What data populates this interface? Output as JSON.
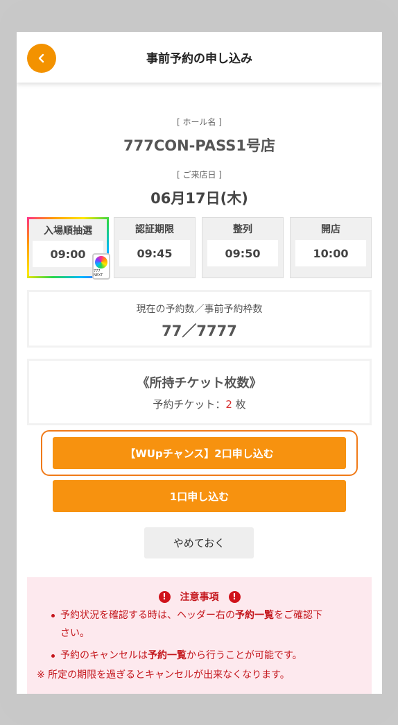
{
  "header": {
    "title": "事前予約の申し込み"
  },
  "hall": {
    "label": "[ ホール名 ]",
    "name": "777CON-PASS1号店"
  },
  "visit": {
    "label": "[ ご来店日 ]",
    "date": "06月17日(木)"
  },
  "schedule": [
    {
      "label": "入場順抽選",
      "time": "09:00"
    },
    {
      "label": "認証期限",
      "time": "09:45"
    },
    {
      "label": "整列",
      "time": "09:50"
    },
    {
      "label": "開店",
      "time": "10:00"
    }
  ],
  "lottery_badge_text": "777 NEXT",
  "reservation": {
    "label": "現在の予約数／事前予約枠数",
    "value": "77／7777"
  },
  "tickets": {
    "title": "《所持チケット枚数》",
    "prefix": "予約チケット：",
    "count": "2",
    "unit": " 枚"
  },
  "buttons": {
    "wup": "【WUpチャンス】2口申し込む",
    "one": "1口申し込む",
    "cancel": "やめておく"
  },
  "notice": {
    "title": "注意事項",
    "item1_pre": "予約状況を確認する時は、ヘッダー右の",
    "item1_bold": "予約一覧",
    "item1_post": "をご確認下",
    "item1_line2": "さい。",
    "item2_pre": "予約のキャンセルは",
    "item2_bold": "予約一覧",
    "item2_post": "から行うことが可能です。",
    "item3": "※ 所定の期限を過ぎるとキャンセルが出来なくなります。"
  }
}
